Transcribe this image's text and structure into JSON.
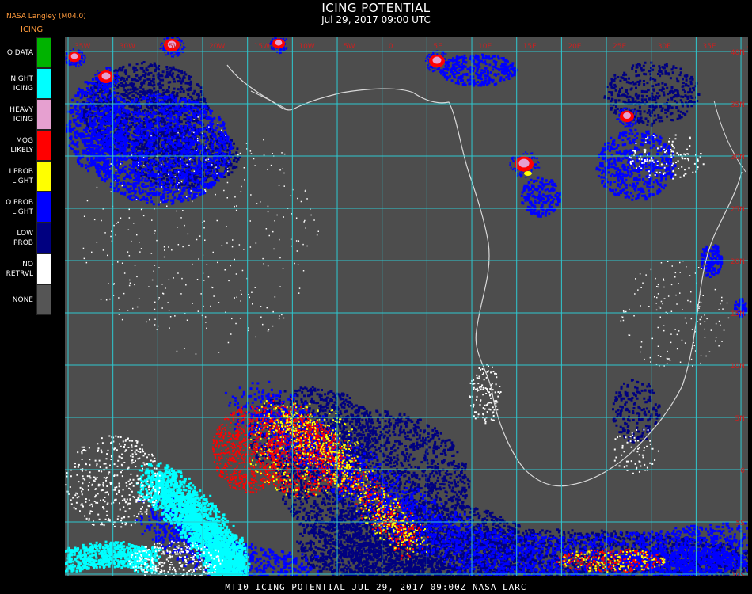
{
  "header": {
    "title": "ICING POTENTIAL",
    "subtitle": "Jul 29, 2017 09:00 UTC",
    "provider": "NASA Langley (M04.0)",
    "product": "ICING"
  },
  "legend": {
    "items": [
      {
        "label": "O DATA",
        "color": "#00b300"
      },
      {
        "label": "NIGHT\nICING",
        "color": "#00ffff"
      },
      {
        "label": "HEAVY\nICING",
        "color": "#e6a0d0"
      },
      {
        "label": "MOG\nLIKELY",
        "color": "#ff0000"
      },
      {
        "label": "I PROB\nLIGHT",
        "color": "#ffff00"
      },
      {
        "label": "O PROB\nLIGHT",
        "color": "#0000ff"
      },
      {
        "label": "LOW\nPROB",
        "color": "#000080"
      },
      {
        "label": "NO\nRETRVL",
        "color": "#ffffff"
      },
      {
        "label": "NONE",
        "color": "#555555"
      }
    ]
  },
  "map": {
    "background_color": "#4d4d4d",
    "grid_color": "#2ec8d0",
    "coast_color": "#d8d8d8",
    "label_color": "#cc2020",
    "top_labels": [
      "35W",
      "30W",
      "25W",
      "20W",
      "15W",
      "10W",
      "5W",
      "0",
      "5E",
      "10E",
      "15E",
      "20E",
      "25E",
      "30E",
      "35E",
      "40E"
    ],
    "right_labels": [
      "40N",
      "35N",
      "30N",
      "25N",
      "20N",
      "15N",
      "10N",
      "5N",
      "0",
      "5S",
      "10S"
    ]
  },
  "footer": {
    "text": "MT10  ICING POTENTIAL   JUL 29, 2017 09:00Z   NASA LARC"
  }
}
